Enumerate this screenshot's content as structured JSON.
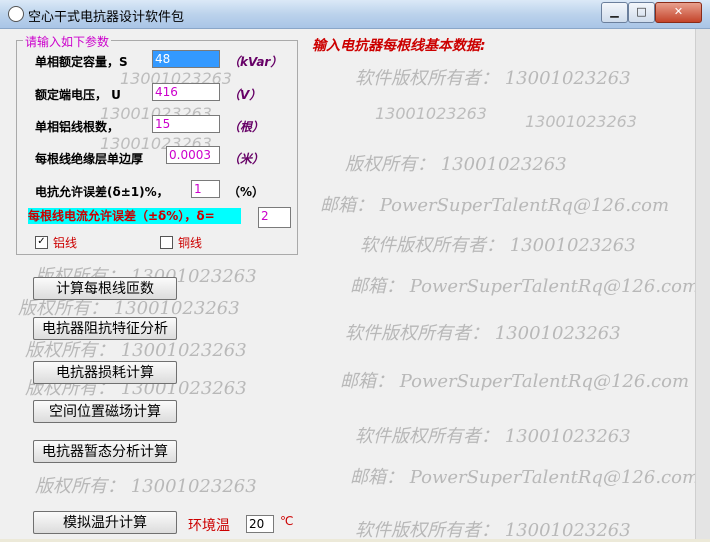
{
  "window": {
    "title": "空心干式电抗器设计软件包",
    "minimize": "▁",
    "maximize": "□",
    "close": "✕"
  },
  "group": {
    "title": "请输入如下参数"
  },
  "fields": {
    "rated_capacity": {
      "label": "单相额定容量，S",
      "value": "48",
      "unit": "（kVar）"
    },
    "rated_voltage": {
      "label": "额定端电压，  U",
      "value": "416",
      "unit": "（V）"
    },
    "wire_count": {
      "label": "单相铝线根数，",
      "value": "15",
      "unit": "（根）"
    },
    "insulation": {
      "label": "每根线绝缘层单边厚",
      "value": "0.0003",
      "unit": "（米）"
    },
    "reactance_error": {
      "label": "电抗允许误差(δ±1)%，",
      "value": "1",
      "unit": "（%）"
    }
  },
  "banner": {
    "label": "每根线电流允许误差（±δ%），δ=",
    "value": "2"
  },
  "materials": {
    "aluminum": {
      "label": "铝线",
      "checked": true
    },
    "copper": {
      "label": "铜线",
      "checked": false
    }
  },
  "buttons": [
    {
      "label": "计算每根线匝数"
    },
    {
      "label": "电抗器阻抗特征分析"
    },
    {
      "label": "电抗器损耗计算"
    },
    {
      "label": "空间位置磁场计算"
    },
    {
      "label": "电抗器暂态分析计算"
    },
    {
      "label": "模拟温升计算"
    }
  ],
  "ambient": {
    "label": "环境温",
    "value": "20",
    "unit": "℃"
  },
  "right_panel": {
    "title": "输入电抗器每根线基本数据:"
  },
  "watermarks": {
    "software_owner": "软件版权所有者：  13001023263",
    "copyright": "版权所有：  13001023263",
    "phone": "13001023263",
    "email": "邮箱：  PowerSuperTalentRq@126.com"
  }
}
